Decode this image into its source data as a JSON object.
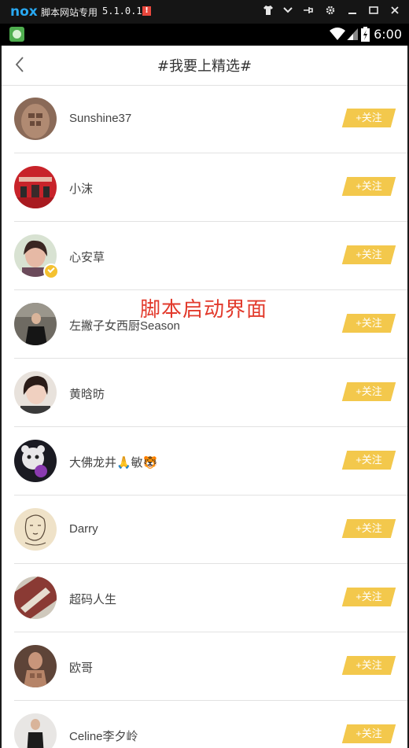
{
  "emulator": {
    "logo": "nox",
    "title": "脚本网站专用",
    "version": "5.1.0.1",
    "alert": "!"
  },
  "status_bar": {
    "time": "6:00"
  },
  "page": {
    "title": "#我要上精选#"
  },
  "users": [
    {
      "name": "Sunshine37",
      "follow": "+关注"
    },
    {
      "name": "小沫",
      "follow": "+关注"
    },
    {
      "name": "心安草",
      "follow": "+关注"
    },
    {
      "name": "左撇子女西厨Season",
      "follow": "+关注"
    },
    {
      "name": "黄晗昉",
      "follow": "+关注"
    },
    {
      "name": "大佛龙井🙏敏🐯",
      "follow": "+关注"
    },
    {
      "name": "Darry",
      "follow": "+关注"
    },
    {
      "name": "超码人生",
      "follow": "+关注"
    },
    {
      "name": "欧哥",
      "follow": "+关注"
    },
    {
      "name": "Celine李夕岭",
      "follow": "+关注"
    }
  ],
  "overlay_text": "脚本启动界面",
  "colors": {
    "follow_button": "#f3c84c",
    "verified_badge": "#f4c130",
    "overlay": "#e23a2c"
  }
}
